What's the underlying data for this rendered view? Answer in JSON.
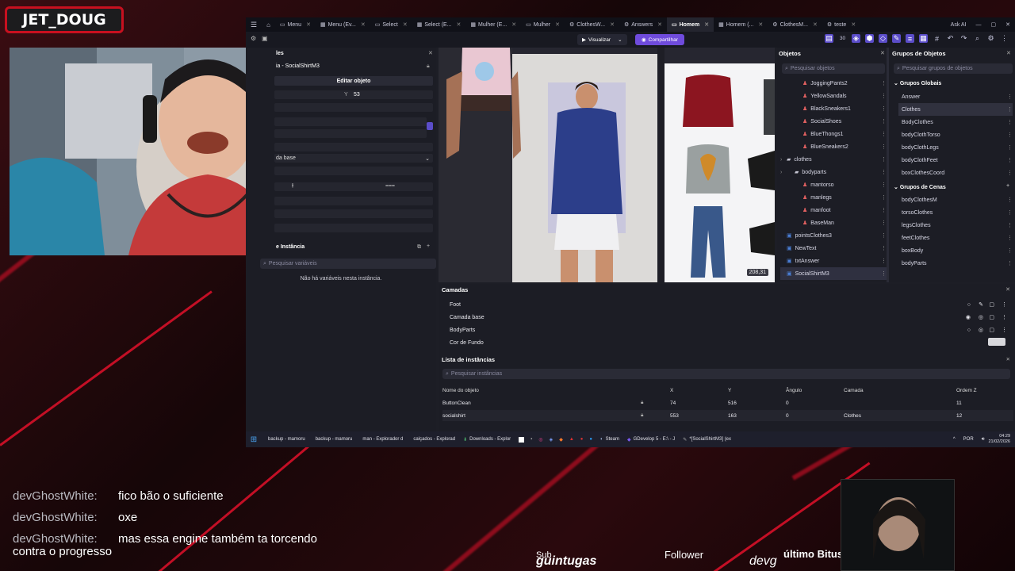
{
  "streamer": {
    "name": "JET_DOUG"
  },
  "app": {
    "tabs": [
      {
        "label": "Menu",
        "icon": "doc-icon"
      },
      {
        "label": "Menu (Ev...",
        "icon": "grid-icon"
      },
      {
        "label": "Select",
        "icon": "doc-icon"
      },
      {
        "label": "Select (E...",
        "icon": "grid-icon"
      },
      {
        "label": "Mulher (E...",
        "icon": "grid-icon"
      },
      {
        "label": "Mulher",
        "icon": "doc-icon"
      },
      {
        "label": "ClothesW...",
        "icon": "gear-icon"
      },
      {
        "label": "Answers",
        "icon": "gear-icon"
      },
      {
        "label": "Homem",
        "icon": "doc-icon",
        "active": true
      },
      {
        "label": "Homem (...",
        "icon": "grid-icon"
      },
      {
        "label": "ClothesM...",
        "icon": "gear-icon"
      },
      {
        "label": "teste",
        "icon": "gear-icon"
      }
    ],
    "ask_ai": "Ask AI",
    "preview_label": "Visualizar",
    "share_label": "Compartilhar",
    "zoom_readout": "30",
    "left_panel": {
      "title_partial": "les",
      "object_partial": "ia - SocialShirtM3",
      "edit_object": "Editar objeto",
      "y_label": "Y",
      "y_value": "53",
      "base_layer_partial": "da base",
      "instance_title": "e Instância",
      "search_vars_placeholder": "Pesquisar variáveis",
      "no_vars": "Não há variáveis nesta instância."
    },
    "canvas": {
      "size_readout": "208,31"
    },
    "objects": {
      "title": "Objetos",
      "search_placeholder": "Pesquisar objetos",
      "items": [
        {
          "label": "JoggingPants2",
          "indent": 2,
          "icon": "person-icon"
        },
        {
          "label": "YellowSandals",
          "indent": 2,
          "icon": "person-icon"
        },
        {
          "label": "BlackSneakers1",
          "indent": 2,
          "icon": "person-icon"
        },
        {
          "label": "SocialShoes",
          "indent": 2,
          "icon": "person-icon"
        },
        {
          "label": "BlueThongs1",
          "indent": 2,
          "icon": "person-icon"
        },
        {
          "label": "BlueSneakers2",
          "indent": 2,
          "icon": "person-icon"
        },
        {
          "label": "clothes",
          "indent": 0,
          "icon": "folder-icon"
        },
        {
          "label": "bodyparts",
          "indent": 1,
          "icon": "folder-icon"
        },
        {
          "label": "mantorso",
          "indent": 2,
          "icon": "person-icon"
        },
        {
          "label": "manlegs",
          "indent": 2,
          "icon": "person-icon"
        },
        {
          "label": "manfoot",
          "indent": 2,
          "icon": "person-icon"
        },
        {
          "label": "BaseMan",
          "indent": 2,
          "icon": "person-icon"
        },
        {
          "label": "pointsClothes3",
          "indent": 0,
          "icon": "square-icon"
        },
        {
          "label": "NewText",
          "indent": 0,
          "icon": "square-icon"
        },
        {
          "label": "txtAnswer",
          "indent": 0,
          "icon": "square-icon"
        },
        {
          "label": "SocialShirtM3",
          "indent": 0,
          "icon": "square-icon",
          "selected": true
        }
      ]
    },
    "groups": {
      "title": "Grupos de Objetos",
      "search_placeholder": "Pesquisar grupos de objetos",
      "global_header": "Grupos Globais",
      "global": [
        "Answer",
        "Clothes",
        "BodyClothes",
        "bodyClothTorso",
        "bodyClothLegs",
        "bodyClothFeet",
        "boxClothesCoord"
      ],
      "scene_header": "Grupos de Cenas",
      "scene": [
        "bodyClothesM",
        "torsoClothes",
        "legsClothes",
        "feetClothes",
        "boxBody",
        "bodyParts"
      ]
    },
    "layers": {
      "title": "Camadas",
      "items": [
        "Foot",
        "Camada base",
        "BodyParts",
        "Cor de Fundo"
      ]
    },
    "instances": {
      "title": "Lista de instâncias",
      "search_placeholder": "Pesquisar instâncias",
      "columns": [
        "Nome do objeto",
        "X",
        "Y",
        "Ângulo",
        "Camada",
        "Ordem Z"
      ],
      "rows": [
        {
          "name": "ButtonClean",
          "x": "74",
          "y": "516",
          "angle": "0",
          "layer": "",
          "z": "11"
        },
        {
          "name": "socialshirt",
          "x": "553",
          "y": "163",
          "angle": "0",
          "layer": "Clothes",
          "z": "12"
        }
      ]
    }
  },
  "taskbar": {
    "items": [
      {
        "label": "backup - mamoru",
        "icon": "folder-icon"
      },
      {
        "label": "backup - mamoru",
        "icon": "folder-icon"
      },
      {
        "label": "man - Explorador d",
        "icon": "folder-icon"
      },
      {
        "label": "calçados - Explorad",
        "icon": "folder-icon"
      },
      {
        "label": "Downloads - Explor",
        "icon": "download-icon"
      },
      {
        "label": "Steam",
        "icon": "steam-icon"
      },
      {
        "label": "GDevelop 5 - E:\\ - J",
        "icon": "gdevelop-icon"
      },
      {
        "label": "*[SocialShirtM3] (ex",
        "icon": "paint-icon"
      }
    ],
    "lang": "POR",
    "time": "04:29",
    "date": "21/02/2026"
  },
  "chat": [
    {
      "user": "devGhostWhite:",
      "msg": "fico bão o suficiente"
    },
    {
      "user": "devGhostWhite:",
      "msg": "oxe"
    },
    {
      "user": "devGhostWhite:",
      "msg": "mas essa engine também ta torcendo"
    }
  ],
  "chat_overflow": "contra o progresso",
  "overlay": {
    "sub_label": "Sub",
    "sub_name": "guintugas",
    "follower_label": "Follower",
    "follower_name": "devg",
    "bits_label": "último Bitus"
  }
}
